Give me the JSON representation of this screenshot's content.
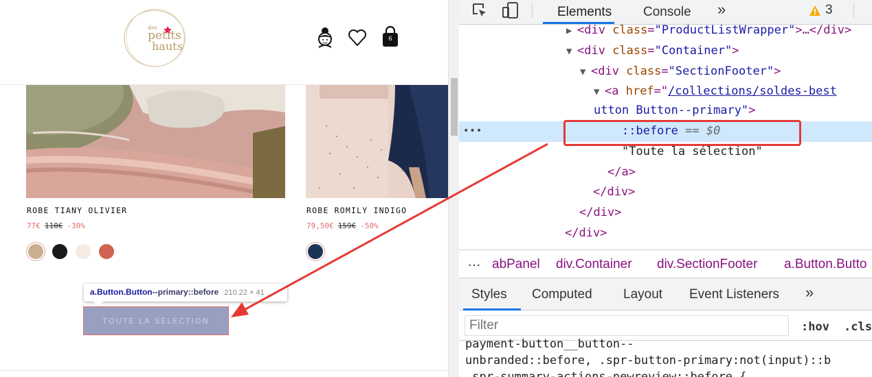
{
  "website": {
    "logo": {
      "word_small": "des",
      "word_1": "petits",
      "word_2": "hauts"
    },
    "header_icons": {
      "account": "person-icon",
      "wishlist": "heart-icon",
      "cart": "bag-icon",
      "cart_count": "6"
    },
    "products": [
      {
        "name": "ROBE TIANY OLIVIER",
        "price": "77€",
        "old_price": "110€",
        "discount": "-30%",
        "swatches": [
          "#c8b08e",
          "#1a1a1a",
          "#f4ece4",
          "#cf6452"
        ]
      },
      {
        "name": "ROBE ROMILY INDIGO",
        "price": "79,50€",
        "old_price": "159€",
        "discount": "-50%",
        "swatches": [
          "#1c3557"
        ]
      }
    ],
    "tooltip": {
      "selector_1": "a.Button.Button",
      "selector_2": "--primary::before",
      "dimensions": "210.22 × 41"
    },
    "cta_label": "TOUTE LA SÉLECTION"
  },
  "devtools": {
    "toolbar": {
      "tabs": [
        "Elements",
        "Console"
      ],
      "more_tabs": "»",
      "warning_count": "3",
      "icons": [
        "inspect-icon",
        "device-toggle-icon",
        "warning-icon",
        "more-icon"
      ]
    },
    "dom_tree": {
      "line1": {
        "tag_open": "<div ",
        "attr": "class",
        "eq": "=",
        "value": "\"ProductListWrapper\"",
        "tag_close": ">…</div>"
      },
      "line2": {
        "tag_open": "<div ",
        "attr": "class",
        "eq": "=",
        "value": "\"Container\"",
        "tag_close": ">"
      },
      "line3": {
        "tag_open": "<div ",
        "attr": "class",
        "eq": "=",
        "value": "\"SectionFooter\"",
        "tag_close": ">"
      },
      "line4": {
        "tag_open": "<a ",
        "attr": "href",
        "eq": "=",
        "value_link": "/collections/soldes-best"
      },
      "line5": {
        "text": "utton Button--primary\"",
        "tag_close": ">"
      },
      "line6": {
        "pseudo": "::before",
        "eq": " == ",
        "dollar": "$0"
      },
      "line7": {
        "text": "\"Toute la sélection\""
      },
      "line8": {
        "tag": "</a>"
      },
      "line9": {
        "tag": "</div>"
      },
      "line10": {
        "tag": "</div>"
      },
      "line11": {
        "tag": "</div>"
      }
    },
    "breadcrumb": [
      "abPanel",
      "div.Container",
      "div.SectionFooter",
      "a.Button.Butto"
    ],
    "styles_tabs": [
      "Styles",
      "Computed",
      "Layout",
      "Event Listeners"
    ],
    "styles_more": "»",
    "filter": {
      "placeholder": "Filter",
      "hov": ":hov",
      "cls": ".cls"
    },
    "css_rules": [
      "payment-button__button--",
      "unbranded::before, .spr-button-primary:not(input)::b",
      ".spr-summary-actions-newreview::before {"
    ]
  },
  "colors": {
    "annotation_red": "#e53935",
    "link_blue": "#1a73e8",
    "sale_pink": "#e56a6a"
  }
}
